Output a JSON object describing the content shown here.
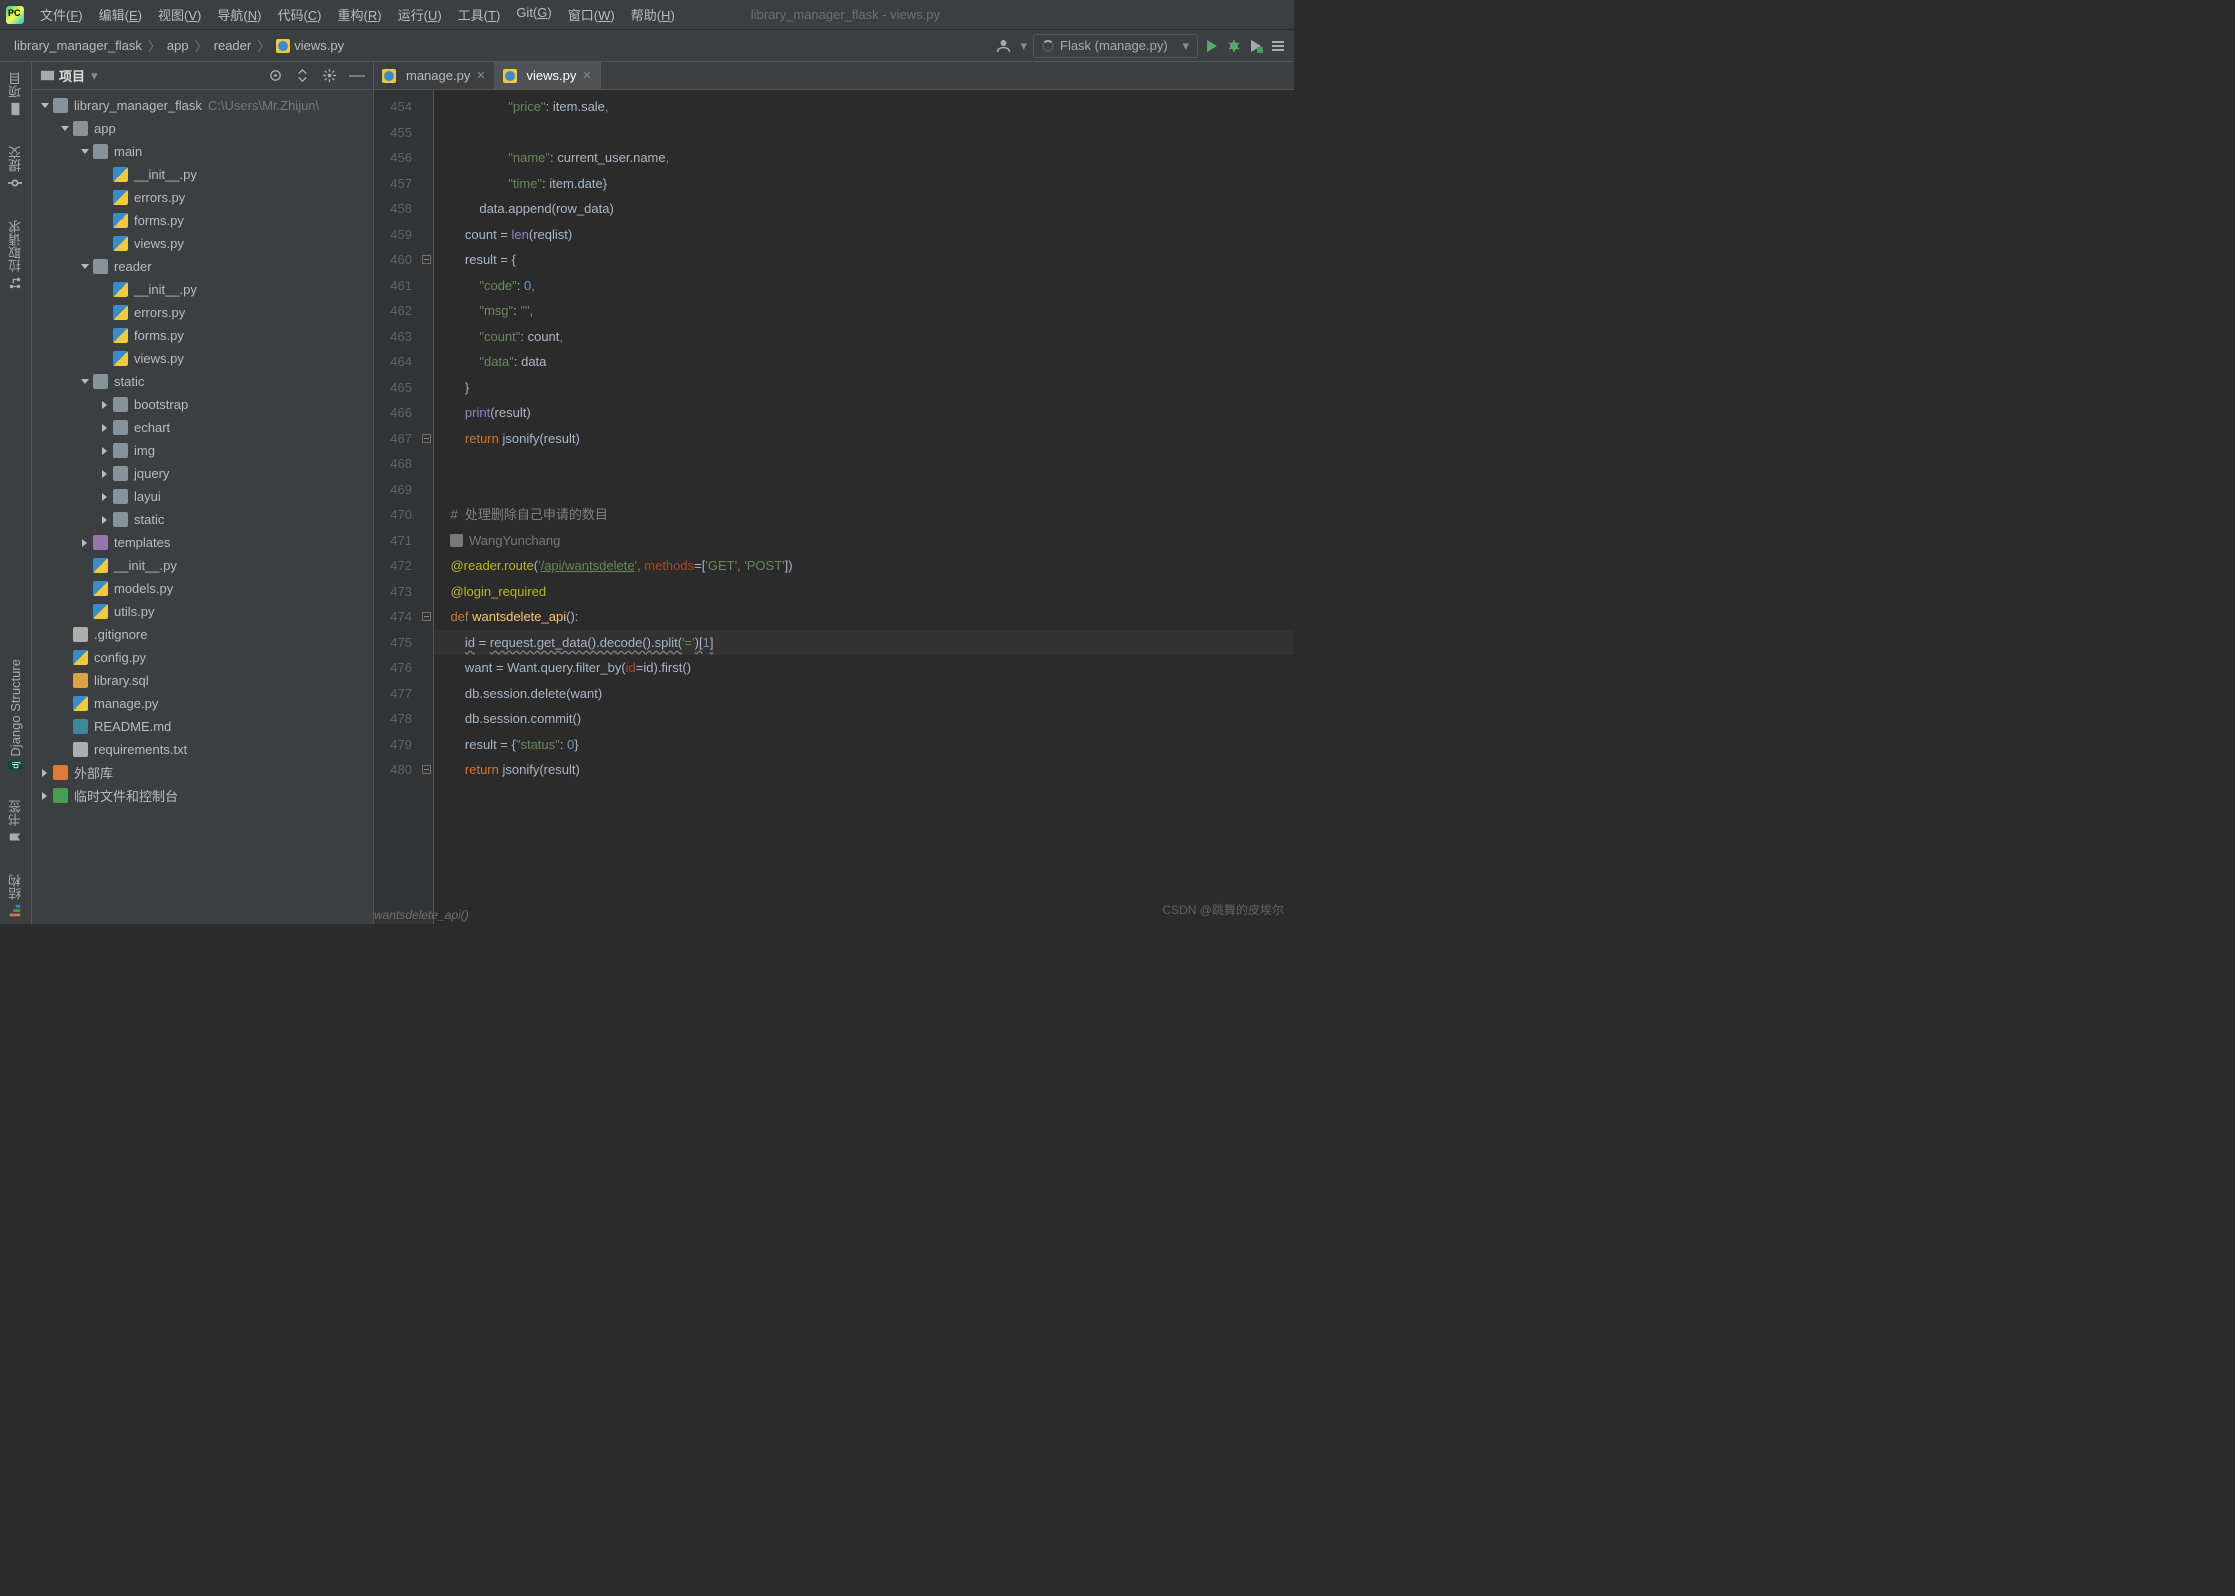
{
  "window_title": "library_manager_flask - views.py",
  "menu": [
    "文件(F)",
    "编辑(E)",
    "视图(V)",
    "导航(N)",
    "代码(C)",
    "重构(R)",
    "运行(U)",
    "工具(T)",
    "Git(G)",
    "窗口(W)",
    "帮助(H)"
  ],
  "breadcrumb": [
    "library_manager_flask",
    "app",
    "reader",
    "views.py"
  ],
  "run_config_label": "Flask (manage.py)",
  "left_gutter": [
    {
      "label": "项目",
      "icon": "folder"
    },
    {
      "label": "提交",
      "icon": "commit"
    },
    {
      "label": "拉取请求",
      "icon": "pullreq"
    },
    {
      "label": "Django Structure",
      "icon": "django"
    },
    {
      "label": "书签",
      "icon": "bookmark"
    },
    {
      "label": "结构",
      "icon": "structure"
    }
  ],
  "proj_header": "项目",
  "tree": [
    {
      "depth": 0,
      "exp": "open",
      "icon": "root",
      "label": "library_manager_flask",
      "hint": "C:\\Users\\Mr.Zhijun\\"
    },
    {
      "depth": 1,
      "exp": "open",
      "icon": "dir",
      "label": "app"
    },
    {
      "depth": 2,
      "exp": "open",
      "icon": "dir",
      "label": "main"
    },
    {
      "depth": 3,
      "icon": "py",
      "label": "__init__.py"
    },
    {
      "depth": 3,
      "icon": "py",
      "label": "errors.py"
    },
    {
      "depth": 3,
      "icon": "py",
      "label": "forms.py"
    },
    {
      "depth": 3,
      "icon": "py",
      "label": "views.py"
    },
    {
      "depth": 2,
      "exp": "open",
      "icon": "dir",
      "label": "reader"
    },
    {
      "depth": 3,
      "icon": "py",
      "label": "__init__.py"
    },
    {
      "depth": 3,
      "icon": "py",
      "label": "errors.py"
    },
    {
      "depth": 3,
      "icon": "py",
      "label": "forms.py"
    },
    {
      "depth": 3,
      "icon": "py",
      "label": "views.py"
    },
    {
      "depth": 2,
      "exp": "open",
      "icon": "dir",
      "label": "static"
    },
    {
      "depth": 3,
      "exp": "closed",
      "icon": "dir",
      "label": "bootstrap"
    },
    {
      "depth": 3,
      "exp": "closed",
      "icon": "dir",
      "label": "echart"
    },
    {
      "depth": 3,
      "exp": "closed",
      "icon": "dir",
      "label": "img"
    },
    {
      "depth": 3,
      "exp": "closed",
      "icon": "dir",
      "label": "jquery"
    },
    {
      "depth": 3,
      "exp": "closed",
      "icon": "dir",
      "label": "layui"
    },
    {
      "depth": 3,
      "exp": "closed",
      "icon": "dir",
      "label": "static"
    },
    {
      "depth": 2,
      "exp": "closed",
      "icon": "dir-s",
      "label": "templates"
    },
    {
      "depth": 2,
      "icon": "py",
      "label": "__init__.py"
    },
    {
      "depth": 2,
      "icon": "py",
      "label": "models.py"
    },
    {
      "depth": 2,
      "icon": "py",
      "label": "utils.py"
    },
    {
      "depth": 1,
      "icon": "txt",
      "label": ".gitignore"
    },
    {
      "depth": 1,
      "icon": "py",
      "label": "config.py"
    },
    {
      "depth": 1,
      "icon": "sql",
      "label": "library.sql"
    },
    {
      "depth": 1,
      "icon": "py",
      "label": "manage.py"
    },
    {
      "depth": 1,
      "icon": "md",
      "label": "README.md"
    },
    {
      "depth": 1,
      "icon": "txt",
      "label": "requirements.txt"
    },
    {
      "depth": 0,
      "exp": "closed",
      "icon": "lib",
      "label": "外部库"
    },
    {
      "depth": 0,
      "exp": "closed",
      "icon": "scratch",
      "label": "临时文件和控制台"
    }
  ],
  "editor_tabs": [
    {
      "label": "manage.py",
      "active": false
    },
    {
      "label": "views.py",
      "active": true
    }
  ],
  "line_start": 454,
  "line_end": 480,
  "current_line": 474,
  "author_annotation": "WangYunchang",
  "comment_text": "#  处理删除自己申请的数目",
  "status_breadcrumb": "wantsdelete_api()",
  "watermark": "CSDN @跳舞的皮埃尔",
  "code_lines": [
    {
      "n": 454,
      "html": "                    <span class='tok-str'>\"price\"</span>: item.sale<span class='tok-kw'>,</span>"
    },
    {
      "n": 455,
      "html": ""
    },
    {
      "n": 456,
      "html": "                    <span class='tok-str'>\"name\"</span>: current_user.name<span class='tok-kw'>,</span>"
    },
    {
      "n": 457,
      "html": "                    <span class='tok-str'>\"time\"</span>: item.date}"
    },
    {
      "n": 458,
      "html": "            data.append(row_data)"
    },
    {
      "n": 459,
      "html": "        count = <span class='tok-builtin'>len</span>(reqlist)"
    },
    {
      "n": 460,
      "html": "        result = {"
    },
    {
      "n": 461,
      "html": "            <span class='tok-str'>\"code\"</span>: <span class='tok-num'>0</span><span class='tok-kw'>,</span>"
    },
    {
      "n": 462,
      "html": "            <span class='tok-str'>\"msg\"</span>: <span class='tok-str'>\"\"</span><span class='tok-kw'>,</span>"
    },
    {
      "n": 463,
      "html": "            <span class='tok-str'>\"count\"</span>: count<span class='tok-kw'>,</span>"
    },
    {
      "n": 464,
      "html": "            <span class='tok-str'>\"data\"</span>: data"
    },
    {
      "n": 465,
      "html": "        }"
    },
    {
      "n": 466,
      "html": "        <span class='tok-builtin'>print</span>(result)"
    },
    {
      "n": 467,
      "html": "        <span class='tok-kw'>return</span> jsonify(result)"
    },
    {
      "n": 468,
      "html": ""
    },
    {
      "n": 469,
      "html": ""
    },
    {
      "n": 470,
      "html": "    <span class='tok-comm'>#  处理删除自己申请的数目</span>"
    },
    {
      "n": "auth",
      "html": "<span class='author-line'><span class='author-ic'></span>WangYunchang</span>"
    },
    {
      "n": 471,
      "html": "    <span class='tok-dec'>@reader.route</span>(<span class='tok-str'>'</span><span class='tok-link'>/api/wantsdelete</span><span class='tok-str'>'</span><span class='tok-kw'>, </span><span class='tok-param'>methods</span>=[<span class='tok-str'>'GET'</span><span class='tok-kw'>, </span><span class='tok-str'>'POST'</span>])"
    },
    {
      "n": 472,
      "html": "    <span class='tok-dec'>@login_required</span>"
    },
    {
      "n": 473,
      "html": "    <span class='tok-kw'>def </span><span class='tok-fn'>wantsdelete_api</span>():"
    },
    {
      "n": 474,
      "html": "        <span class='tok-warn'>id</span> = <span class='tok-warn'>request.get_data().decode().split(</span><span class='tok-str'>'='</span><span class='tok-warn'>)[</span><span class='tok-num'>1</span><span class='tok-warn'>]</span>",
      "hl": true
    },
    {
      "n": 475,
      "html": "        want = Want.query.filter_by(<span class='tok-param'>id</span>=id).first()"
    },
    {
      "n": 476,
      "html": "        db.session.delete(want)"
    },
    {
      "n": 477,
      "html": "        db.session.commit()"
    },
    {
      "n": 478,
      "html": "        result = {<span class='tok-str'>\"status\"</span>: <span class='tok-num'>0</span>}"
    },
    {
      "n": 479,
      "html": "        <span class='tok-kw'>return</span> jsonify(result)"
    },
    {
      "n": 480,
      "html": ""
    }
  ]
}
